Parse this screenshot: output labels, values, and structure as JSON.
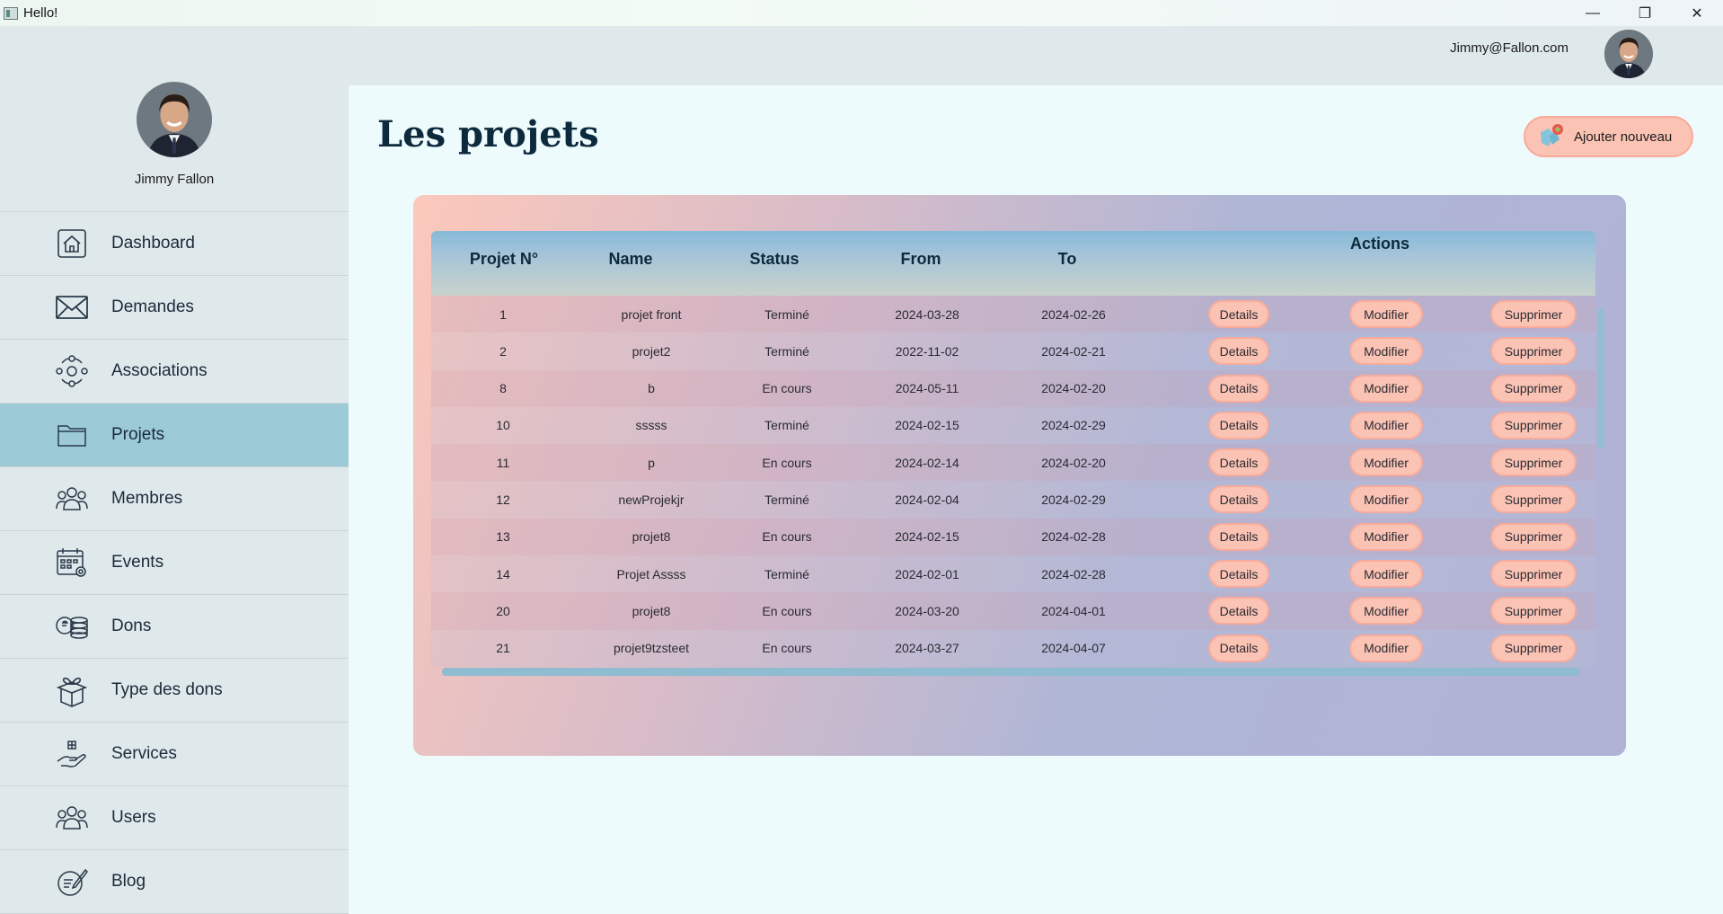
{
  "window": {
    "title": "Hello!",
    "controls": {
      "minimize": "—",
      "restore": "❐",
      "close": "✕"
    }
  },
  "header": {
    "email": "Jimmy@Fallon.com",
    "avatar_icon": "user-avatar"
  },
  "sidebar": {
    "profile_name": "Jimmy Fallon",
    "items": [
      {
        "label": "Dashboard",
        "icon": "home-icon"
      },
      {
        "label": "Demandes",
        "icon": "envelope-icon"
      },
      {
        "label": "Associations",
        "icon": "network-icon"
      },
      {
        "label": "Projets",
        "icon": "folder-icon",
        "active": true
      },
      {
        "label": "Membres",
        "icon": "group-icon"
      },
      {
        "label": "Events",
        "icon": "calendar-gear-icon"
      },
      {
        "label": "Dons",
        "icon": "coins-icon"
      },
      {
        "label": "Type des dons",
        "icon": "gift-box-icon"
      },
      {
        "label": "Services",
        "icon": "hand-box-icon"
      },
      {
        "label": "Users",
        "icon": "users-icon"
      },
      {
        "label": "Blog",
        "icon": "blog-edit-icon"
      }
    ]
  },
  "main": {
    "title": "Les projets",
    "add_button": "Ajouter nouveau",
    "table": {
      "headers": {
        "id": "Projet N°",
        "name": "Name",
        "status": "Status",
        "from": "From",
        "to": "To",
        "actions": "Actions"
      },
      "action_labels": {
        "details": "Details",
        "modify": "Modifier",
        "delete": "Supprimer"
      },
      "rows": [
        {
          "id": "1",
          "name": "projet front",
          "status": "Terminé",
          "from": "2024-03-28",
          "to": "2024-02-26"
        },
        {
          "id": "2",
          "name": "projet2",
          "status": "Terminé",
          "from": "2022-11-02",
          "to": "2024-02-21"
        },
        {
          "id": "8",
          "name": "b",
          "status": "En cours",
          "from": "2024-05-11",
          "to": "2024-02-20"
        },
        {
          "id": "10",
          "name": "sssss",
          "status": "Terminé",
          "from": "2024-02-15",
          "to": "2024-02-29"
        },
        {
          "id": "11",
          "name": "p",
          "status": "En cours",
          "from": "2024-02-14",
          "to": "2024-02-20"
        },
        {
          "id": "12",
          "name": "newProjekjr",
          "status": "Terminé",
          "from": "2024-02-04",
          "to": "2024-02-29"
        },
        {
          "id": "13",
          "name": "projet8",
          "status": "En cours",
          "from": "2024-02-15",
          "to": "2024-02-28"
        },
        {
          "id": "14",
          "name": "Projet Assss",
          "status": "Terminé",
          "from": "2024-02-01",
          "to": "2024-02-28"
        },
        {
          "id": "20",
          "name": "projet8",
          "status": "En cours",
          "from": "2024-03-20",
          "to": "2024-04-01"
        },
        {
          "id": "21",
          "name": "projet9tzsteet",
          "status": "En cours",
          "from": "2024-03-27",
          "to": "2024-04-07"
        }
      ]
    }
  },
  "colors": {
    "accent_pill": "#fbc3b4",
    "active_nav": "#9dcad7",
    "title_color": "#0d2a3d"
  }
}
